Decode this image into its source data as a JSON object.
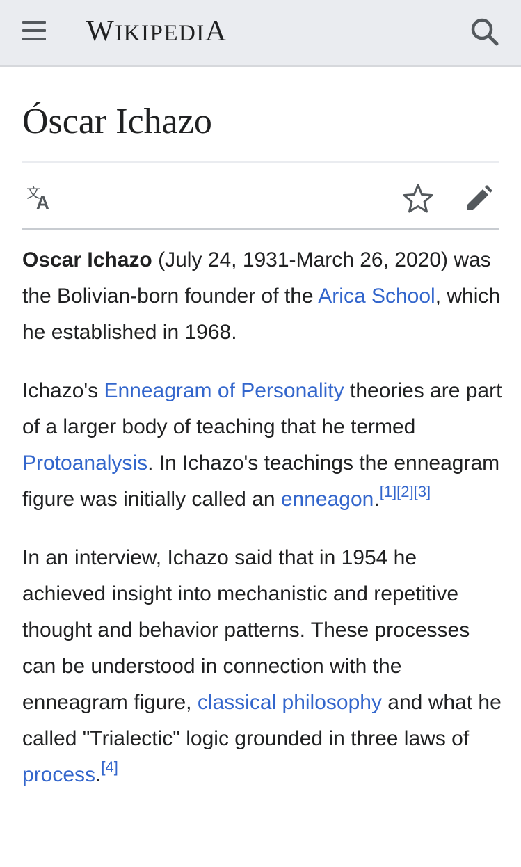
{
  "header": {
    "menu_icon": "hamburger-menu-icon",
    "search_icon": "search-icon",
    "wordmark": {
      "w_cap": "W",
      "iki": "IKIPEDI",
      "a_cap": "A"
    }
  },
  "page": {
    "title": "Óscar Ichazo",
    "actions": {
      "language_icon": "translate-icon",
      "watch_icon": "star-icon",
      "edit_icon": "pencil-icon"
    }
  },
  "colors": {
    "link": "#3366cc",
    "header_bg": "#eaecf0",
    "text": "#202122"
  },
  "paragraphs": {
    "p1": {
      "name": "Oscar Ichazo",
      "t1": " (July 24, 1931-March 26, 2020) was the Bolivian-born founder of the ",
      "link1": "Arica School",
      "t2": ", which he established in 1968."
    },
    "p2": {
      "t1": "Ichazo's ",
      "link1": "Enneagram of Personality",
      "t2": " theories are part of a larger body of teaching that he termed ",
      "link2": "Protoanalysis",
      "t3": ". In Ichazo's teachings the enneagram figure was initially called an ",
      "link3": "enneagon",
      "t4": ".",
      "ref1": "[1]",
      "ref2": "[2]",
      "ref3": "[3]"
    },
    "p3": {
      "t1": "In an interview, Ichazo said that in 1954 he achieved insight into mechanistic and repetitive thought and behavior patterns. These processes can be understood in connection with the enneagram figure, ",
      "link1": "classical philosophy",
      "t2": " and what he called \"Trialectic\" logic grounded in three laws of ",
      "link2": "process",
      "t3": ".",
      "ref1": "[4]"
    }
  }
}
